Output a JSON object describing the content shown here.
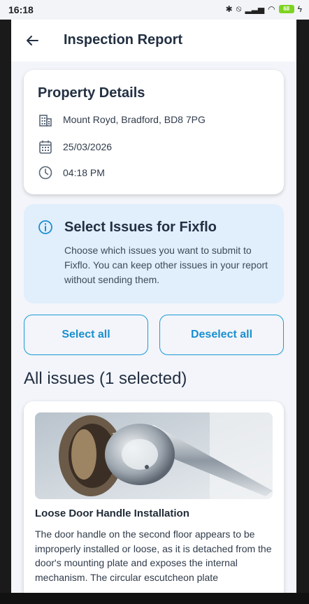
{
  "status_bar": {
    "time": "16:18",
    "battery": "68"
  },
  "app_bar": {
    "title": "Inspection Report"
  },
  "property": {
    "heading": "Property Details",
    "address": "Mount Royd, Bradford, BD8 7PG",
    "date": "25/03/2026",
    "time": "04:18 PM"
  },
  "info": {
    "title": "Select Issues for Fixflo",
    "body": "Choose which issues you want to submit to Fixflo. You can keep other issues in your report without sending them."
  },
  "actions": {
    "select_all": "Select all",
    "deselect_all": "Deselect all"
  },
  "issues": {
    "heading": "All issues (1 selected)",
    "items": [
      {
        "title": "Loose Door Handle Installation",
        "description": "The door handle on the second floor appears to be improperly installed or loose, as it is detached from the door's mounting plate and exposes the internal mechanism. The circular escutcheon plate"
      }
    ]
  },
  "colors": {
    "accent": "#1a9ad6",
    "info_bg": "#e1eefb",
    "page_bg": "#f3f5fa"
  }
}
